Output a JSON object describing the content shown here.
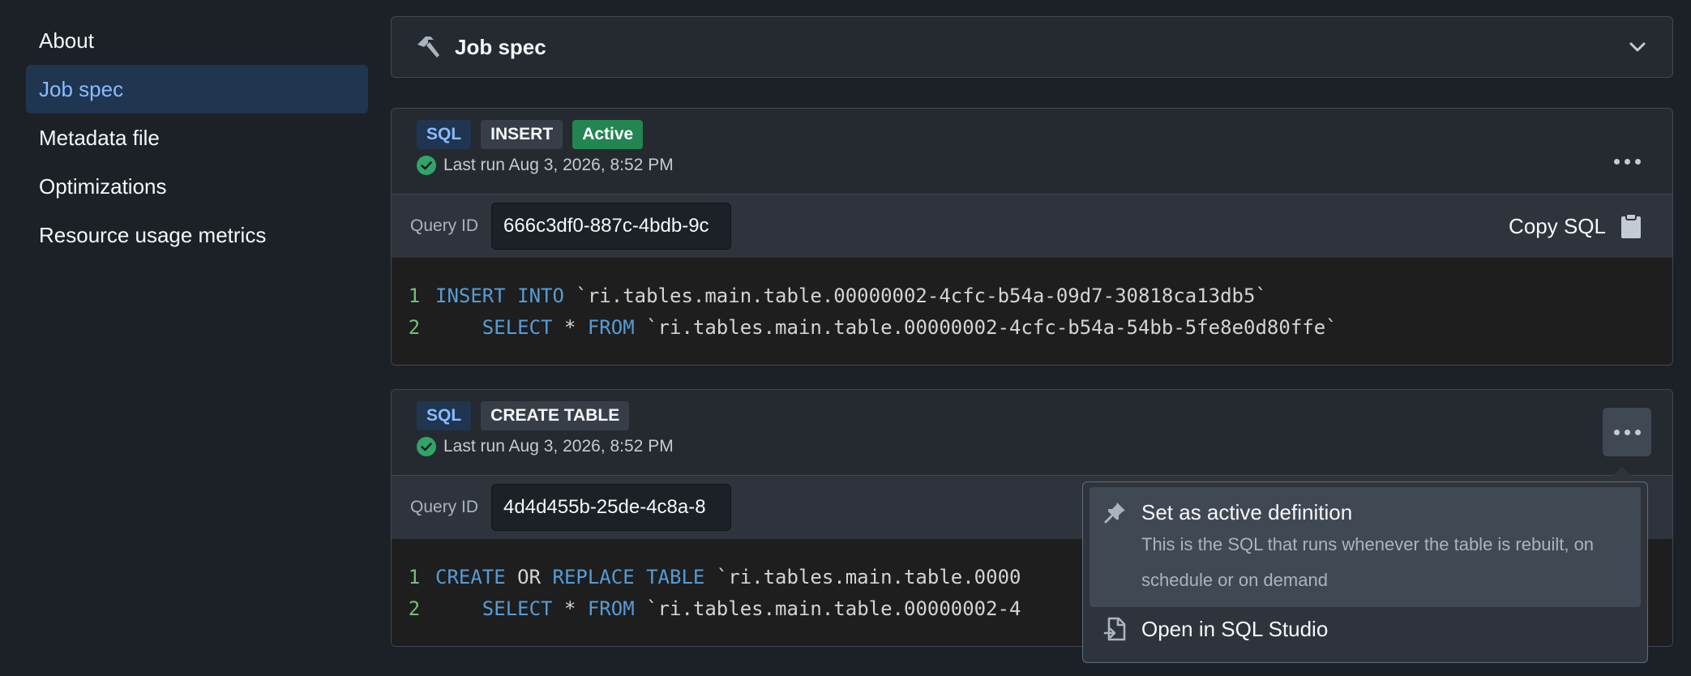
{
  "sidebar": {
    "items": [
      {
        "label": "About",
        "active": false
      },
      {
        "label": "Job spec",
        "active": true
      },
      {
        "label": "Metadata file",
        "active": false
      },
      {
        "label": "Optimizations",
        "active": false
      },
      {
        "label": "Resource usage metrics",
        "active": false
      }
    ]
  },
  "section": {
    "title": "Job spec",
    "icon": "hammer-icon",
    "toggle_icon": "chevron-down-icon"
  },
  "cards": [
    {
      "tags": [
        "SQL",
        "INSERT",
        "Active"
      ],
      "last_run": "Last run Aug 3, 2026, 8:52 PM",
      "query_label": "Query ID",
      "query_id": "666c3df0-887c-4bdb-9c",
      "copy_label": "Copy SQL",
      "code": [
        {
          "n": "1",
          "parts": [
            {
              "t": "INSERT INTO",
              "k": true
            },
            {
              "t": " `ri.tables.main.table.00000002-4cfc-b54a-09d7-30818ca13db5`",
              "k": false
            }
          ]
        },
        {
          "n": "2",
          "parts": [
            {
              "t": "    ",
              "k": false
            },
            {
              "t": "SELECT",
              "k": true
            },
            {
              "t": " * ",
              "k": false
            },
            {
              "t": "FROM",
              "k": true
            },
            {
              "t": " `ri.tables.main.table.00000002-4cfc-b54a-54bb-5fe8e0d80ffe`",
              "k": false
            }
          ]
        }
      ]
    },
    {
      "tags": [
        "SQL",
        "CREATE TABLE"
      ],
      "last_run": "Last run Aug 3, 2026, 8:52 PM",
      "query_label": "Query ID",
      "query_id": "4d4d455b-25de-4c8a-8",
      "code": [
        {
          "n": "1",
          "parts": [
            {
              "t": "CREATE",
              "k": true
            },
            {
              "t": " OR ",
              "k": false
            },
            {
              "t": "REPLACE TABLE",
              "k": true
            },
            {
              "t": " `ri.tables.main.table.0000",
              "k": false
            }
          ]
        },
        {
          "n": "2",
          "parts": [
            {
              "t": "    ",
              "k": false
            },
            {
              "t": "SELECT",
              "k": true
            },
            {
              "t": " * ",
              "k": false
            },
            {
              "t": "FROM",
              "k": true
            },
            {
              "t": " `ri.tables.main.table.00000002-4",
              "k": false
            }
          ]
        }
      ]
    }
  ],
  "menu": {
    "items": [
      {
        "label": "Set as active definition",
        "description": "This is the SQL that runs whenever the table is rebuilt, on schedule or on demand",
        "icon": "pin-icon"
      },
      {
        "label": "Open in SQL Studio",
        "icon": "open-file-icon"
      }
    ]
  },
  "colors": {
    "accent": "#8abbff",
    "active_tag": "#238551",
    "keyword": "#569cd6",
    "line_number": "#72c07a"
  }
}
